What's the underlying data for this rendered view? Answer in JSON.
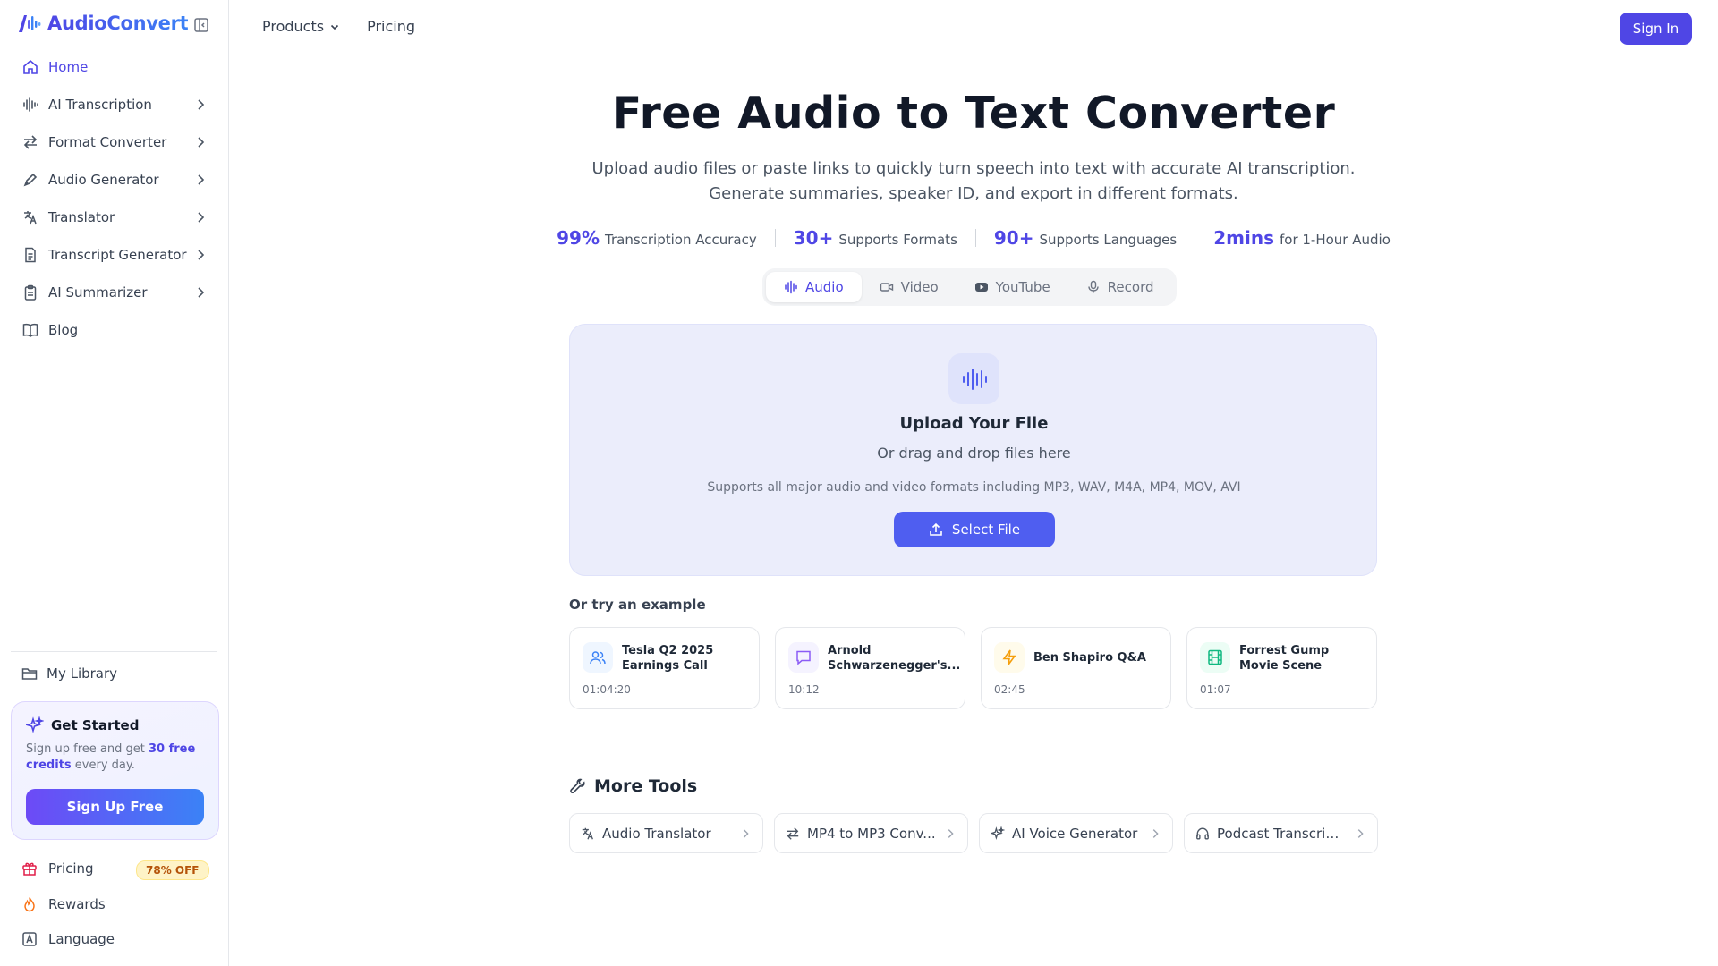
{
  "brand": {
    "name": "AudioConvert"
  },
  "sidebar": {
    "items": [
      {
        "label": "Home",
        "icon": "home-icon",
        "active": true
      },
      {
        "label": "AI Transcription",
        "icon": "waveform-icon"
      },
      {
        "label": "Format Converter",
        "icon": "arrows-swap-icon"
      },
      {
        "label": "Audio Generator",
        "icon": "pen-icon"
      },
      {
        "label": "Translator",
        "icon": "translate-icon"
      },
      {
        "label": "Transcript Generator",
        "icon": "document-icon"
      },
      {
        "label": "AI Summarizer",
        "icon": "clipboard-icon"
      },
      {
        "label": "Blog",
        "icon": "book-icon"
      }
    ],
    "library": "My Library",
    "promo": {
      "title": "Get Started",
      "text_before": "Sign up free and get ",
      "text_bold": "30 free credits",
      "text_after": " every day.",
      "button": "Sign Up Free"
    },
    "bottom": {
      "pricing": "Pricing",
      "pricing_badge": "78% OFF",
      "rewards": "Rewards",
      "language": "Language"
    }
  },
  "topnav": {
    "products": "Products",
    "pricing": "Pricing",
    "signin": "Sign In"
  },
  "hero": {
    "title": "Free Audio to Text Converter",
    "subtitle_line1": "Upload audio files or paste links to quickly turn speech into text with accurate AI transcription.",
    "subtitle_line2": "Generate summaries, speaker ID, and export in different formats."
  },
  "stats": [
    {
      "num": "99%",
      "label": "Transcription Accuracy"
    },
    {
      "num": "30+",
      "label": "Supports Formats"
    },
    {
      "num": "90+",
      "label": "Supports Languages"
    },
    {
      "num": "2mins",
      "label": "for 1-Hour Audio"
    }
  ],
  "tabs": [
    {
      "label": "Audio",
      "active": true
    },
    {
      "label": "Video"
    },
    {
      "label": "YouTube"
    },
    {
      "label": "Record"
    }
  ],
  "upload": {
    "title": "Upload Your File",
    "subtitle": "Or drag and drop files here",
    "formats": "Supports all major audio and video formats including MP3, WAV, M4A, MP4, MOV, AVI",
    "button": "Select File"
  },
  "examples": {
    "heading": "Or try an example",
    "items": [
      {
        "title": "Tesla Q2 2025 Earnings Call",
        "time": "01:04:20",
        "icon": "users-icon",
        "color": "#3b82f6",
        "bg": "#eff6ff"
      },
      {
        "title": "Arnold Schwarzenegger's...",
        "time": "10:12",
        "icon": "chat-bubble-icon",
        "color": "#8b5cf6",
        "bg": "#f5f3ff"
      },
      {
        "title": "Ben Shapiro Q&A",
        "time": "02:45",
        "icon": "lightning-icon",
        "color": "#f59e0b",
        "bg": "#fffbeb"
      },
      {
        "title": "Forrest Gump Movie Scene",
        "time": "01:07",
        "icon": "film-icon",
        "color": "#10b981",
        "bg": "#ecfdf5"
      }
    ]
  },
  "tools": {
    "heading": "More Tools",
    "items": [
      {
        "label": "Audio Translator",
        "icon": "translate-icon"
      },
      {
        "label": "MP4 to MP3 Conv...",
        "icon": "arrows-swap-icon"
      },
      {
        "label": "AI Voice Generator",
        "icon": "sparkle-icon"
      },
      {
        "label": "Podcast Transcrip...",
        "icon": "headphones-icon"
      }
    ]
  }
}
